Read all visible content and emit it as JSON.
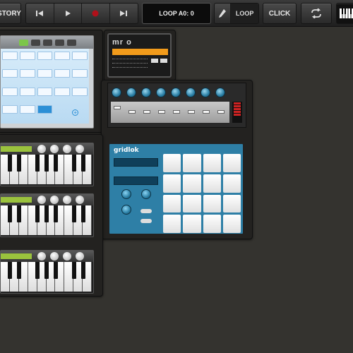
{
  "topbar": {
    "history_label": "STORY",
    "loop_display": "LOOP A0: 0",
    "loop_label": "LOOP",
    "click_label": "CLICK"
  },
  "devices": {
    "mmo_logo": "mr o",
    "gridlok_title": "gridlok"
  },
  "colors": {
    "background": "#34332f",
    "accent_orange": "#f29b1b",
    "gridlok_blue": "#2e7fa6",
    "lcd_green": "#9ac23d"
  }
}
